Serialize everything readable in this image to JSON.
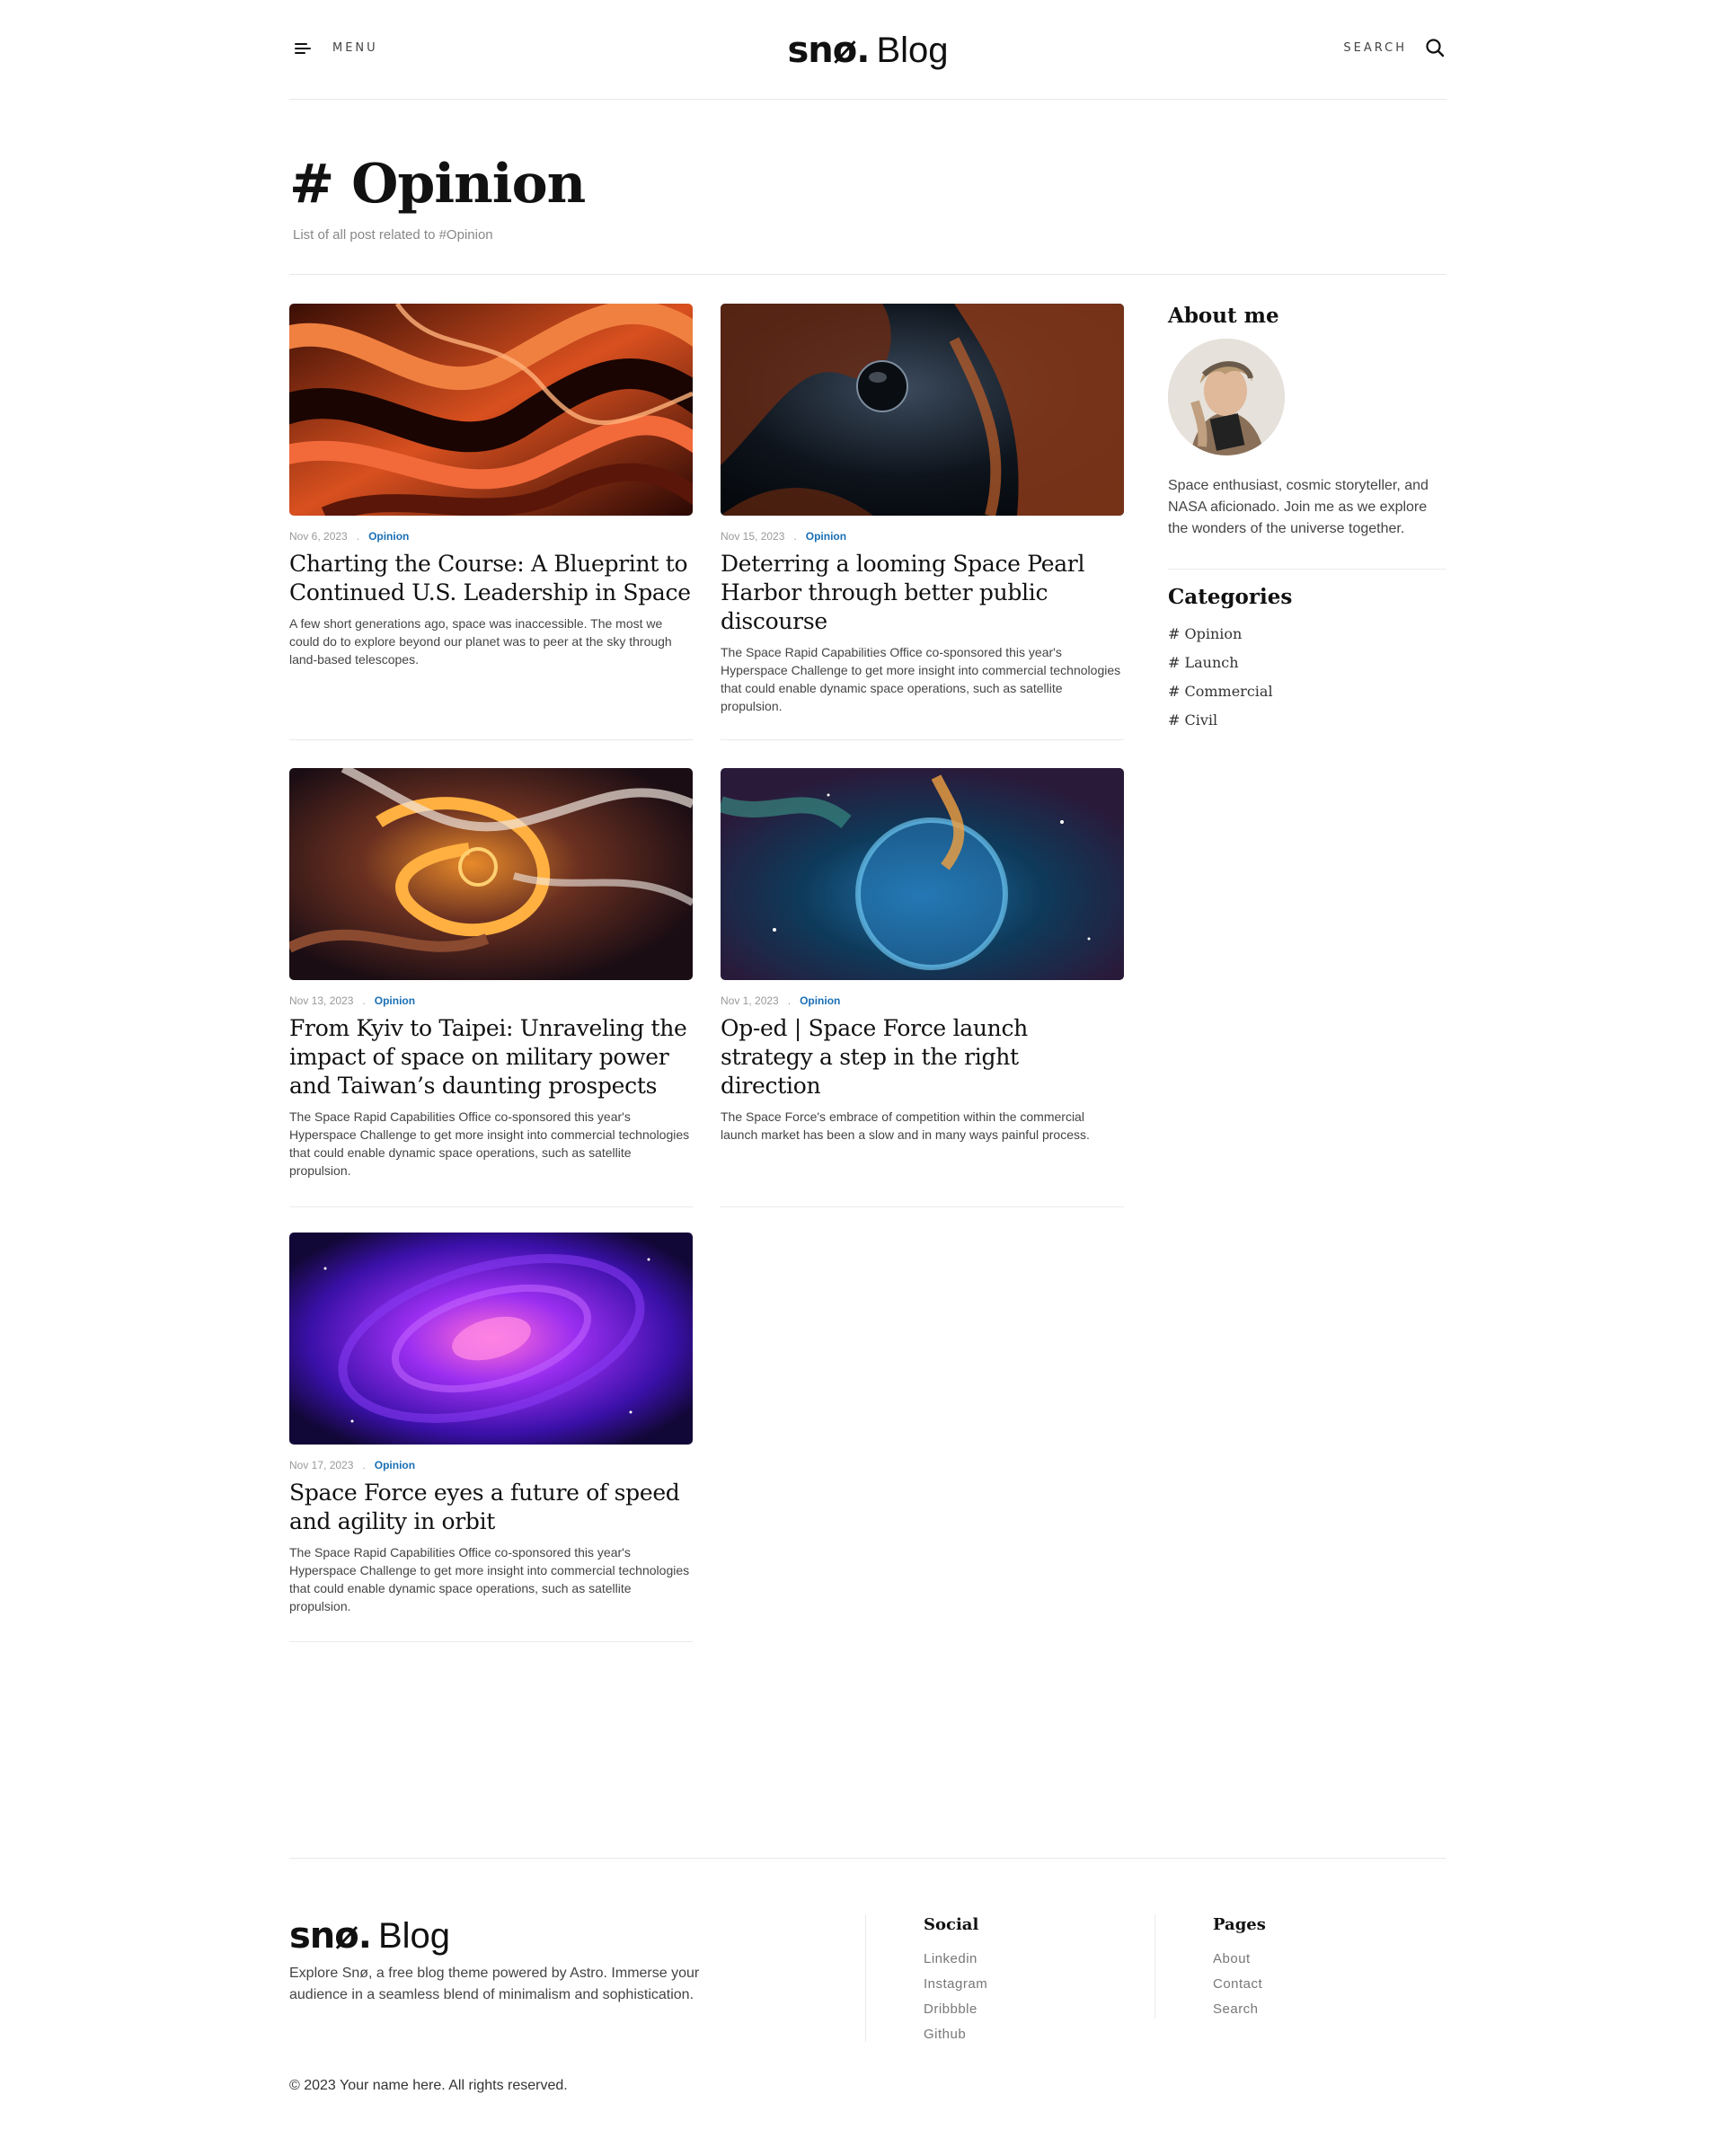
{
  "header": {
    "menu_label": "MENU",
    "logo_bold": "snø.",
    "logo_light": "Blog",
    "search_label": "SEARCH"
  },
  "page": {
    "title": "# Opinion",
    "subtitle": "List of all post related to #Opinion"
  },
  "posts": [
    {
      "date": "Nov 6, 2023",
      "category": "Opinion",
      "title": "Charting the Course: A Blueprint to Continued U.S. Leadership in Space",
      "excerpt": "A few short generations ago, space was inaccessible. The most we could do to explore beyond our planet was to peer at the sky through land-based telescopes.",
      "image": "orange-lava-swirl"
    },
    {
      "date": "Nov 15, 2023",
      "category": "Opinion",
      "title": "Deterring a looming Space Pearl Harbor through better public discourse",
      "excerpt": "The Space Rapid Capabilities Office co-sponsored this year's Hyperspace Challenge to get more insight into commercial technologies that could enable dynamic space operations, such as satellite propulsion.",
      "image": "dark-orange-planet"
    },
    {
      "date": "Nov 13, 2023",
      "category": "Opinion",
      "title": "From Kyiv to Taipei: Unraveling the impact of space on military power and Taiwan’s daunting prospects",
      "excerpt": "The Space Rapid Capabilities Office co-sponsored this year's Hyperspace Challenge to get more insight into commercial technologies that could enable dynamic space operations, such as satellite propulsion.",
      "image": "orange-smoke-swirl"
    },
    {
      "date": "Nov 1, 2023",
      "category": "Opinion",
      "title": "Op-ed | Space Force launch strategy a step in the right direction",
      "excerpt": "The Space Force's embrace of competition within the commercial launch market has been a slow and in many ways painful process.",
      "image": "blue-nebula"
    },
    {
      "date": "Nov 17, 2023",
      "category": "Opinion",
      "title": "Space Force eyes a future of speed and agility in orbit",
      "excerpt": "The Space Rapid Capabilities Office co-sponsored this year's Hyperspace Challenge to get more insight into commercial technologies that could enable dynamic space operations, such as satellite propulsion.",
      "image": "purple-galaxy"
    }
  ],
  "sidebar": {
    "about_heading": "About me",
    "about_text": "Space enthusiast, cosmic storyteller, and NASA aficionado. Join me as we explore the wonders of the universe together.",
    "categories_heading": "Categories",
    "categories": [
      "# Opinion",
      "# Launch",
      "# Commercial",
      "# Civil"
    ]
  },
  "footer": {
    "logo_bold": "snø.",
    "logo_light": "Blog",
    "description": "Explore Snø, a free blog theme powered by Astro. Immerse your audience in a seamless blend of minimalism and sophistication.",
    "copyright": "© 2023 Your name here. All rights reserved.",
    "social_heading": "Social",
    "social_links": [
      "Linkedin",
      "Instagram",
      "Dribbble",
      "Github"
    ],
    "pages_heading": "Pages",
    "pages_links": [
      "About",
      "Contact",
      "Search"
    ]
  },
  "colors": {
    "accent": "#1a6fb5",
    "text": "#111111",
    "muted": "#888888",
    "divider": "#e8e8e8"
  }
}
